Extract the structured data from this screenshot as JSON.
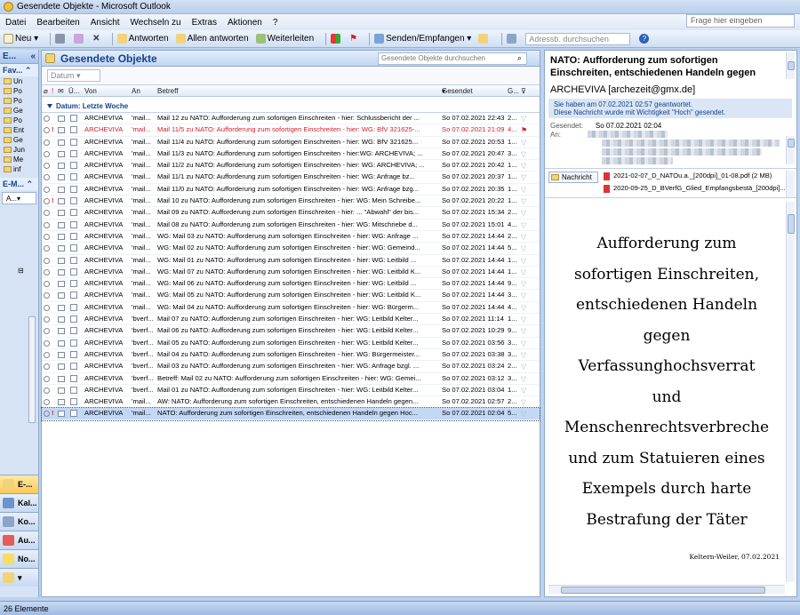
{
  "window": {
    "title": "Gesendete Objekte - Microsoft Outlook"
  },
  "menu": [
    "Datei",
    "Bearbeiten",
    "Ansicht",
    "Wechseln zu",
    "Extras",
    "Aktionen",
    "?"
  ],
  "help_placeholder": "Frage hier eingeben",
  "toolbar": {
    "new": "Neu",
    "reply": "Antworten",
    "reply_all": "Allen antworten",
    "forward": "Weiterleiten",
    "send_receive": "Senden/Empfangen",
    "address_search": "Adressb. durchsuchen"
  },
  "nav": {
    "header": "E...",
    "favorites": "Fav...",
    "mail_section": "E-M...",
    "folders": [
      "Un",
      "Po",
      "Po",
      "Ge",
      "Po",
      "Ent",
      "Ge",
      "Jun",
      "Me",
      "inf"
    ],
    "search_short": "A...",
    "buttons": [
      "E-...",
      "Kal...",
      "Ko...",
      "Au...",
      "No..."
    ]
  },
  "list": {
    "title": "Gesendete Objekte",
    "search_placeholder": "Gesendete Objekte durchsuchen",
    "arrange": "Datum",
    "columns": {
      "from": "Von",
      "to": "An",
      "subject": "Betreff",
      "sent": "Gesendet",
      "size": "G...",
      "flags": "Ü..."
    },
    "group": "Datum: Letzte Woche",
    "rows": [
      {
        "from": "ARCHEVIVA",
        "to": "'mail...",
        "subject": "Mail 12 zu NATO: Aufforderung zum sofortigen Einschreiten - hier: Schlussbericht der ...",
        "date": "So 07.02.2021 22:43",
        "size": "2...",
        "red": false,
        "imp": false
      },
      {
        "from": "ARCHEVIVA",
        "to": "'mail...",
        "subject": "Mail 11/5 zu NATO: Aufforderung zum sofortigen Einschreiten - hier: WG: BfV 321625-...",
        "date": "So 07.02.2021 21:09",
        "size": "4...",
        "red": true,
        "imp": true
      },
      {
        "from": "ARCHEVIVA",
        "to": "'mail...",
        "subject": "Mail 11/4 zu NATO: Aufforderung zum sofortigen Einschreiten - hier: WG: BfV 321625...",
        "date": "So 07.02.2021 20:53",
        "size": "1...",
        "red": false,
        "imp": false
      },
      {
        "from": "ARCHEVIVA",
        "to": "'mail...",
        "subject": "Mail 11/3 zu NATO: Aufforderung zum sofortigen Einschreiten - hier:WG: ARCHEVIVA; ...",
        "date": "So 07.02.2021 20:47",
        "size": "3...",
        "red": false,
        "imp": false
      },
      {
        "from": "ARCHEVIVA",
        "to": "'mail...",
        "subject": "Mail 11/2 zu NATO: Aufforderung zum sofortigen Einschreiten - hier: WG: ARCHEVIVA; ...",
        "date": "So 07.02.2021 20:42",
        "size": "1...",
        "red": false,
        "imp": false
      },
      {
        "from": "ARCHEVIVA",
        "to": "'mail...",
        "subject": "Mail 11/1 zu NATO: Aufforderung zum sofortigen Einschreiten - hier: WG: Anfrage bz...",
        "date": "So 07.02.2021 20:37",
        "size": "1...",
        "red": false,
        "imp": false
      },
      {
        "from": "ARCHEVIVA",
        "to": "'mail...",
        "subject": "Mail 11/0 zu NATO: Aufforderung zum sofortigen Einschreiten - hier: WG: Anfrage bzg...",
        "date": "So 07.02.2021 20:35",
        "size": "1...",
        "red": false,
        "imp": false
      },
      {
        "from": "ARCHEVIVA",
        "to": "'mail...",
        "subject": "Mail 10 zu NATO: Aufforderung zum sofortigen Einschreiten - hier: WG: Mein Schreibe...",
        "date": "So 07.02.2021 20:22",
        "size": "1...",
        "red": false,
        "imp": true
      },
      {
        "from": "ARCHEVIVA",
        "to": "'mail...",
        "subject": "Mail 09 zu NATO: Aufforderung zum sofortigen Einschreiten - hier: ... \"Abwahl\" der bis...",
        "date": "So 07.02.2021 15:34",
        "size": "2...",
        "red": false,
        "imp": false
      },
      {
        "from": "ARCHEVIVA",
        "to": "'mail...",
        "subject": "Mail 08 zu NATO: Aufforderung zum sofortigen Einschreiten - hier: WG: Mitschriebe d...",
        "date": "So 07.02.2021 15:01",
        "size": "4...",
        "red": false,
        "imp": false
      },
      {
        "from": "ARCHEVIVA",
        "to": "'mail...",
        "subject": "WG: Mail 03 zu NATO: Aufforderung zum sofortigen Einschreiten - hier: WG: Anfrage ...",
        "date": "So 07.02.2021 14:44",
        "size": "2...",
        "red": false,
        "imp": false
      },
      {
        "from": "ARCHEVIVA",
        "to": "'mail...",
        "subject": "WG: Mail 02 zu NATO: Aufforderung zum sofortigen Einschreiten - hier: WG: Gemeind...",
        "date": "So 07.02.2021 14:44",
        "size": "5...",
        "red": false,
        "imp": false
      },
      {
        "from": "ARCHEVIVA",
        "to": "'mail...",
        "subject": "WG: Mail 01 zu NATO: Aufforderung zum sofortigen Einschreiten - hier: WG: Leitbild ...",
        "date": "So 07.02.2021 14:44",
        "size": "1...",
        "red": false,
        "imp": false
      },
      {
        "from": "ARCHEVIVA",
        "to": "'mail...",
        "subject": "WG: Mail 07 zu NATO: Aufforderung zum sofortigen Einschreiten - hier: WG: Leitbild K...",
        "date": "So 07.02.2021 14:44",
        "size": "1...",
        "red": false,
        "imp": false
      },
      {
        "from": "ARCHEVIVA",
        "to": "'mail...",
        "subject": "WG: Mail 06 zu NATO: Aufforderung zum sofortigen Einschreiten - hier:  WG: Leitbild ...",
        "date": "So 07.02.2021 14:44",
        "size": "9...",
        "red": false,
        "imp": false
      },
      {
        "from": "ARCHEVIVA",
        "to": "'mail...",
        "subject": "WG: Mail 05 zu NATO: Aufforderung zum sofortigen Einschreiten - hier: WG: Leitbild K...",
        "date": "So 07.02.2021 14:44",
        "size": "3...",
        "red": false,
        "imp": false
      },
      {
        "from": "ARCHEVIVA",
        "to": "'mail...",
        "subject": "WG: Mail 04 zu NATO: Aufforderung zum sofortigen Einschreiten - hier: WG: Bürgerm...",
        "date": "So 07.02.2021 14:44",
        "size": "4...",
        "red": false,
        "imp": false
      },
      {
        "from": "ARCHEVIVA",
        "to": "'bverf...",
        "subject": "Mail 07 zu NATO: Aufforderung zum sofortigen Einschreiten - hier: WG: Leitbild Kelter...",
        "date": "So 07.02.2021 11:14",
        "size": "1...",
        "red": false,
        "imp": false
      },
      {
        "from": "ARCHEVIVA",
        "to": "'bverf...",
        "subject": "Mail 06 zu NATO: Aufforderung zum sofortigen Einschreiten - hier:  WG: Leitbild Kelter...",
        "date": "So 07.02.2021 10:29",
        "size": "9...",
        "red": false,
        "imp": false
      },
      {
        "from": "ARCHEVIVA",
        "to": "'bverf...",
        "subject": "Mail 05 zu NATO: Aufforderung zum sofortigen Einschreiten - hier: WG: Leitbild Kelter...",
        "date": "So 07.02.2021 03:56",
        "size": "3...",
        "red": false,
        "imp": false
      },
      {
        "from": "ARCHEVIVA",
        "to": "'bverf...",
        "subject": "Mail 04 zu NATO: Aufforderung zum sofortigen Einschreiten - hier: WG: Bürgermeister...",
        "date": "So 07.02.2021 03:38",
        "size": "3...",
        "red": false,
        "imp": false
      },
      {
        "from": "ARCHEVIVA",
        "to": "'bverf...",
        "subject": "Mail 03 zu NATO: Aufforderung zum sofortigen Einschreiten - hier: WG: Anfrage bzgl. ...",
        "date": "So 07.02.2021 03:24",
        "size": "2...",
        "red": false,
        "imp": false
      },
      {
        "from": "ARCHEVIVA",
        "to": "'bverf...",
        "subject": "Betreff: Mail 02 zu NATO: Aufforderung zum sofortigen Einschreiten - hier: WG: Gemei...",
        "date": "So 07.02.2021 03:12",
        "size": "3...",
        "red": false,
        "imp": false
      },
      {
        "from": "ARCHEVIVA",
        "to": "'bverf...",
        "subject": "Mail 01 zu NATO: Aufforderung zum sofortigen Einschreiten - hier: WG: Leitbild Kelter...",
        "date": "So 07.02.2021 03:04",
        "size": "1...",
        "red": false,
        "imp": false
      },
      {
        "from": "ARCHEVIVA",
        "to": "'mail...",
        "subject": "AW: NATO: Aufforderung zum sofortigen Einschreiten, entschiedenen Handeln gegen...",
        "date": "So 07.02.2021 02:57",
        "size": "2...",
        "red": false,
        "imp": false
      },
      {
        "from": "ARCHEVIVA",
        "to": "'mail...",
        "subject": "NATO: Aufforderung zum sofortigen Einschreiten, entschiedenen Handeln gegen Hoc...",
        "date": "So 07.02.2021 02:04",
        "size": "5...",
        "red": false,
        "imp": true,
        "sel": true
      }
    ]
  },
  "reading": {
    "subject": "NATO: Aufforderung zum sofortigen Einschreiten, entschiedenen Handeln gegen",
    "from": "ARCHEVIVA [archezeit@gmx.de]",
    "info1": "Sie haben am 07.02.2021 02:57 geantwortet.",
    "info2": "Diese Nachricht wurde mit Wichtigkeit \"Hoch\" gesendet.",
    "sent_label": "Gesendet:",
    "sent_value": "So 07.02.2021 02:04",
    "to_label": "An:",
    "message_tab": "Nachricht",
    "attachments": [
      "2021-02-07_D_NATOu.a._[200dpi]_01-08.pdf (2 MB)",
      "2020-09-25_D_BVerfG_Glied_Empfangsbestä_[200dpi]..."
    ],
    "body_lines": [
      "Aufforderung zum",
      "sofortigen Einschreiten,",
      "entschiedenen Handeln",
      "gegen",
      "Verfassunghochsverrat",
      "und",
      "Menschenrechtsverbreche",
      "und zum Statuieren eines",
      "Exempels durch harte",
      "Bestrafung der Täter"
    ],
    "signature": "Keltern-Weiler, 07.02.2021"
  },
  "status": "26 Elemente"
}
